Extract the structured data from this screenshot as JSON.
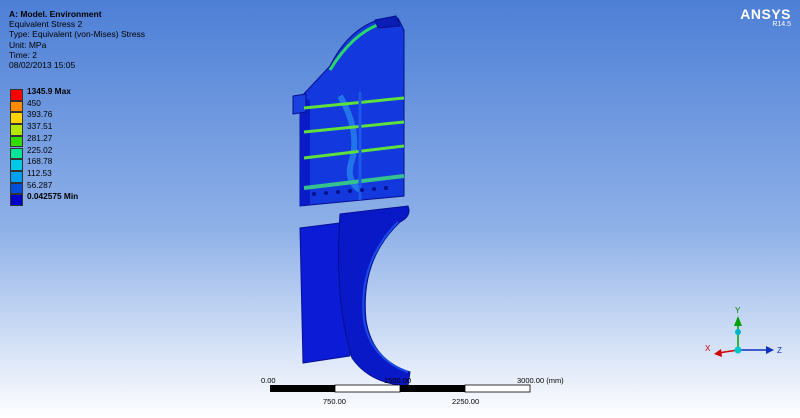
{
  "info": {
    "title": "A: Model. Environment",
    "result": "Equivalent Stress 2",
    "type": "Type: Equivalent (von-Mises) Stress",
    "unit": "Unit: MPa",
    "time": "Time: 2",
    "date": "08/02/2013 15:05"
  },
  "logo": {
    "brand": "ANSYS",
    "version": "R14.5"
  },
  "legend": {
    "labels": [
      "1345.9 Max",
      "450",
      "393.76",
      "337.51",
      "281.27",
      "225.02",
      "168.78",
      "112.53",
      "56.287",
      "0.042575 Min"
    ],
    "colors": [
      "#ff0000",
      "#ff8c00",
      "#ffd200",
      "#b4e600",
      "#32dc00",
      "#00e696",
      "#00c8e6",
      "#00a0f0",
      "#0050dc",
      "#0000c8"
    ]
  },
  "scale": {
    "top_labels": [
      "0.00",
      "1500.00",
      "3000.00 (mm)"
    ],
    "bottom_labels": [
      "750.00",
      "2250.00"
    ]
  },
  "triad": {
    "x": "X",
    "y": "Y",
    "z": "Z"
  }
}
